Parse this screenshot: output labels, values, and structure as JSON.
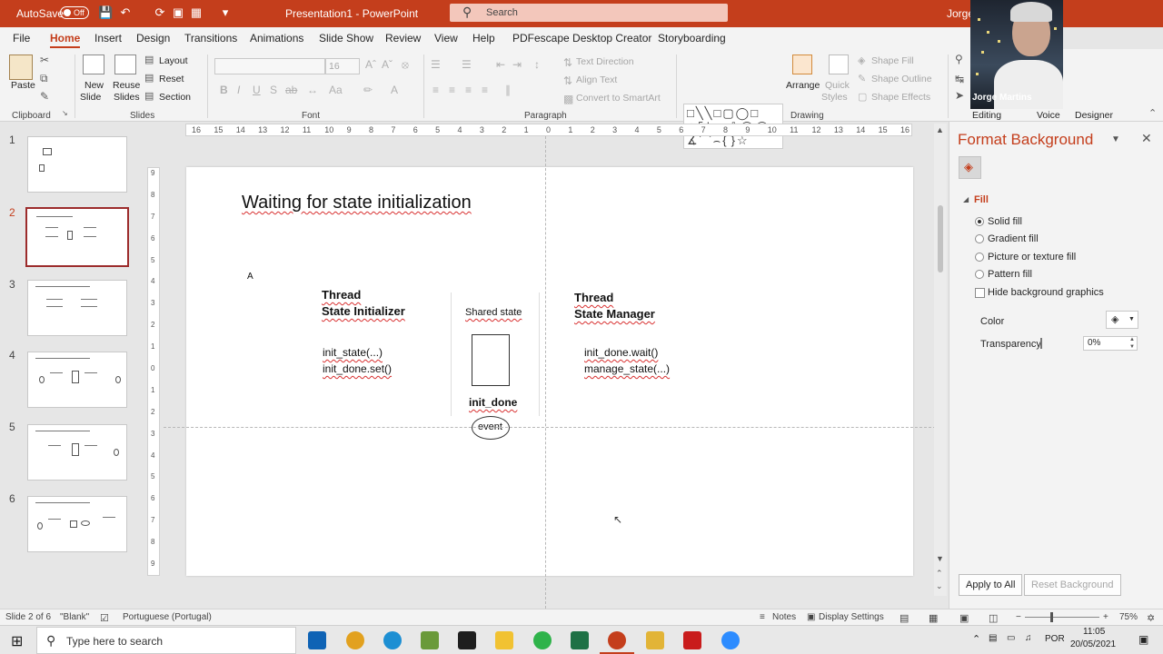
{
  "titlebar": {
    "autosave": "AutoSave",
    "autosave_state": "Off",
    "doc_title": "Presentation1  -  PowerPoint",
    "search_placeholder": "Search",
    "user": "Jorge"
  },
  "menu": {
    "tabs": [
      "File",
      "Home",
      "Insert",
      "Design",
      "Transitions",
      "Animations",
      "Slide Show",
      "Review",
      "View",
      "Help",
      "PDFescape Desktop Creator",
      "Storyboarding"
    ],
    "active": "Home",
    "right_tabs": [
      "Editing",
      "Voice",
      "Designer"
    ]
  },
  "ribbon": {
    "clipboard": {
      "paste": "Paste",
      "group": "Clipboard"
    },
    "slides": {
      "new_slide_1": "New",
      "new_slide_2": "Slide",
      "reuse_1": "Reuse",
      "reuse_2": "Slides",
      "layout": "Layout",
      "reset": "Reset",
      "section": "Section",
      "group": "Slides"
    },
    "font": {
      "size": "16",
      "group": "Font"
    },
    "paragraph": {
      "text_direction": "Text Direction",
      "align_text": "Align Text",
      "convert_smartart": "Convert to SmartArt",
      "group": "Paragraph"
    },
    "drawing": {
      "arrange": "Arrange",
      "quick_1": "Quick",
      "quick_2": "Styles",
      "shape_fill": "Shape Fill",
      "shape_outline": "Shape Outline",
      "shape_effects": "Shape Effects",
      "group": "Drawing"
    }
  },
  "video": {
    "name": "Jorge Martins"
  },
  "thumbnails": {
    "numbers": [
      "1",
      "2",
      "3",
      "4",
      "5",
      "6"
    ],
    "active": "2"
  },
  "rulers": {
    "horizontal": [
      "16",
      "15",
      "14",
      "13",
      "12",
      "11",
      "10",
      "9",
      "8",
      "7",
      "6",
      "5",
      "4",
      "3",
      "2",
      "1",
      "0",
      "1",
      "2",
      "3",
      "4",
      "5",
      "6",
      "7",
      "8",
      "9",
      "10",
      "11",
      "12",
      "13",
      "14",
      "15",
      "16"
    ],
    "vertical": [
      "9",
      "8",
      "7",
      "6",
      "5",
      "4",
      "3",
      "2",
      "1",
      "0",
      "1",
      "2",
      "3",
      "4",
      "5",
      "6",
      "7",
      "8",
      "9"
    ]
  },
  "slide": {
    "title": "Waiting for state initialization",
    "marker": "A",
    "left": {
      "heading1": "Thread",
      "heading2": "State Initializer",
      "line1": "init_state(...)",
      "line2": "init_done.set()"
    },
    "center": {
      "label": "Shared state",
      "box_label": "init_done",
      "ellipse_label": "event"
    },
    "right": {
      "heading1": "Thread",
      "heading2": "State Manager",
      "line1": "init_done.wait()",
      "line2": "manage_state(...)"
    }
  },
  "format_pane": {
    "title": "Format Background",
    "section": "Fill",
    "options": {
      "solid": "Solid fill",
      "gradient": "Gradient fill",
      "picture": "Picture or texture fill",
      "pattern": "Pattern fill",
      "hide": "Hide background graphics"
    },
    "selected": "Solid fill",
    "color_label": "Color",
    "transparency_label": "Transparency",
    "transparency_value": "0%",
    "apply_all": "Apply to All",
    "reset_background": "Reset Background"
  },
  "statusbar": {
    "slide_info": "Slide 2 of 6",
    "theme": "\"Blank\"",
    "language": "Portuguese (Portugal)",
    "notes": "Notes",
    "display": "Display Settings",
    "zoom": "75%"
  },
  "taskbar": {
    "search_placeholder": "Type here to search",
    "lang": "POR",
    "time": "11:05",
    "date": "20/05/2021"
  },
  "colors": {
    "accent": "#c43e1c",
    "active_slide_border": "#9c2c2c"
  }
}
